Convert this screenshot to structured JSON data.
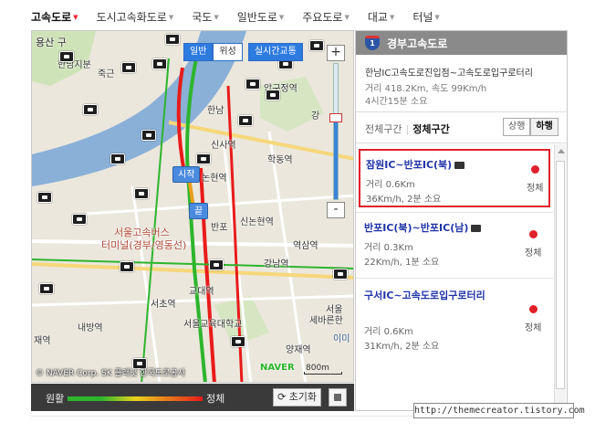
{
  "nav": {
    "items": [
      {
        "label": "고속도로",
        "active": true
      },
      {
        "label": "도시고속화도로",
        "active": false
      },
      {
        "label": "국도",
        "active": false
      },
      {
        "label": "일반도로",
        "active": false
      },
      {
        "label": "주요도로",
        "active": false
      },
      {
        "label": "대교",
        "active": false
      },
      {
        "label": "터널",
        "active": false
      }
    ]
  },
  "map": {
    "buttons": {
      "general": "일반",
      "satellite": "위성",
      "traffic": "실시간교통"
    },
    "zoom": {
      "plus": "+",
      "minus": "-"
    },
    "start_pin": "시작",
    "end_pin": "끝",
    "labels": {
      "yongsan": "용산 구",
      "hannam_sb": "한남지분",
      "jukgeun": "죽근",
      "hannam": "한남",
      "apgujeong": "압구정역",
      "gang": "강",
      "sinsa": "신사역",
      "nonhyeon": "논현역",
      "hakdong": "학동역",
      "sinnonhyeon": "신논현역",
      "banpo_ic": "반포",
      "express_bus": "서울고속버스",
      "terminal": "터미널(경부/영동선)",
      "yeoksam": "역삼역",
      "gangnam": "강남역",
      "gyodae": "교대역",
      "seocho": "서초역",
      "naebang": "내방역",
      "seoul_edu": "서울교육대학교",
      "yangjae": "양재역",
      "jaenae": "재역",
      "seoul_art": "세바른한",
      "seoul_art2": "서울",
      "seoulnam": "이미"
    },
    "copyright": "© NAVER Corp. SK 플래닛 한국도로공사",
    "naver": "NAVER",
    "scale": "800m",
    "zoom_level_fraction": 0.6
  },
  "legend": {
    "low": "원활",
    "high": "정체",
    "reset": "초기화"
  },
  "panel": {
    "badge": "1",
    "title": "경부고속도로",
    "route": "한남IC고속도로진입점~고속도로입구로터리",
    "meta1": "거리 418.2Km, 속도 99Km/h",
    "meta2": "4시간15분 소요",
    "tab_all": "전체구간",
    "tab_congested": "정체구간",
    "dir_up": "상행",
    "dir_down": "하행",
    "items": [
      {
        "name": "잠원IC~반포IC(북)",
        "dist": "거리 0.6Km",
        "speed": "36Km/h, 2분 소요",
        "status": "정체"
      },
      {
        "name": "반포IC(북)~반포IC(남)",
        "dist": "거리 0.3Km",
        "speed": "22Km/h, 1분 소요",
        "status": "정체"
      },
      {
        "name": "구서IC~고속도로입구로터리",
        "dist": "거리 0.6Km",
        "speed": "31Km/h, 2분 소요",
        "status": "정체"
      }
    ]
  },
  "watermark": "http://themecreator.tistory.com",
  "colors": {
    "accent": "#2e7be0",
    "jam": "#e0202a",
    "link": "#1f33a8"
  }
}
